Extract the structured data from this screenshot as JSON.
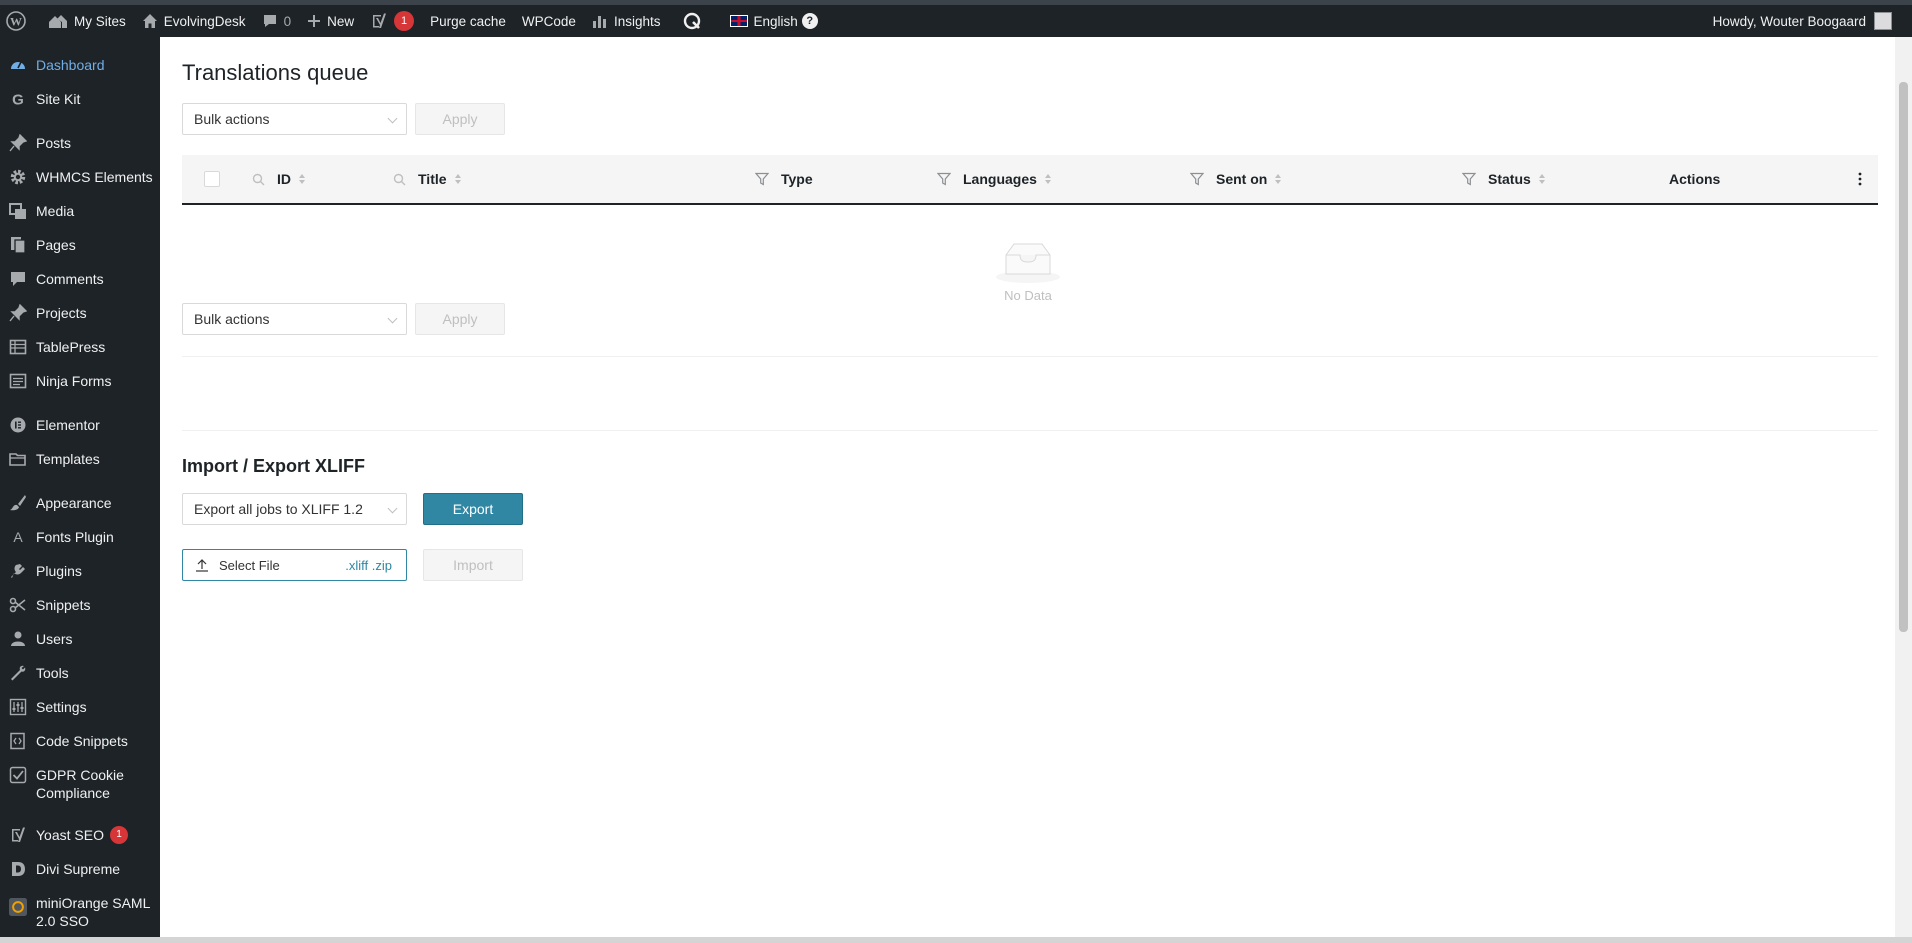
{
  "adminbar": {
    "my_sites": "My Sites",
    "site_name": "EvolvingDesk",
    "comments_count": "0",
    "new_label": "New",
    "yoast_badge": "1",
    "purge_cache": "Purge cache",
    "wpcode": "WPCode",
    "insights": "Insights",
    "language": "English",
    "help": "?",
    "howdy": "Howdy, Wouter Boogaard"
  },
  "sidebar": {
    "items": [
      {
        "label": "Dashboard",
        "icon": "dashboard-icon"
      },
      {
        "label": "Site Kit",
        "icon": "google-icon"
      },
      {
        "label": "Posts",
        "icon": "pin-icon"
      },
      {
        "label": "WHMCS Elements",
        "icon": "gear-icon"
      },
      {
        "label": "Media",
        "icon": "media-icon"
      },
      {
        "label": "Pages",
        "icon": "pages-icon"
      },
      {
        "label": "Comments",
        "icon": "comment-icon"
      },
      {
        "label": "Projects",
        "icon": "pin-icon"
      },
      {
        "label": "TablePress",
        "icon": "table-icon"
      },
      {
        "label": "Ninja Forms",
        "icon": "form-icon"
      },
      {
        "label": "Elementor",
        "icon": "elementor-icon"
      },
      {
        "label": "Templates",
        "icon": "folder-icon"
      },
      {
        "label": "Appearance",
        "icon": "brush-icon"
      },
      {
        "label": "Fonts Plugin",
        "icon": "font-icon"
      },
      {
        "label": "Plugins",
        "icon": "plug-icon"
      },
      {
        "label": "Snippets",
        "icon": "scissors-icon"
      },
      {
        "label": "Users",
        "icon": "user-icon"
      },
      {
        "label": "Tools",
        "icon": "wrench-icon"
      },
      {
        "label": "Settings",
        "icon": "settings-icon"
      },
      {
        "label": "Code Snippets",
        "icon": "code-icon"
      },
      {
        "label": "GDPR Cookie Compliance",
        "icon": "check-icon"
      },
      {
        "label": "Yoast SEO",
        "icon": "yoast-icon",
        "badge": "1"
      },
      {
        "label": "Divi Supreme",
        "icon": "divi-icon"
      },
      {
        "label": "miniOrange SAML 2.0 SSO",
        "icon": "miniorange-icon"
      }
    ]
  },
  "page": {
    "title": "Translations queue",
    "bulk_actions": "Bulk actions",
    "apply": "Apply",
    "columns": {
      "id": "ID",
      "title": "Title",
      "type": "Type",
      "languages": "Languages",
      "sent_on": "Sent on",
      "status": "Status",
      "actions": "Actions"
    },
    "no_data": "No Data",
    "import_export_title": "Import / Export XLIFF",
    "export_select": "Export all jobs to XLIFF 1.2",
    "export_button": "Export",
    "select_file": "Select File",
    "file_types": ".xliff .zip",
    "import_button": "Import"
  },
  "colors": {
    "admin_bg": "#1d2327",
    "active_link": "#72aee6",
    "primary_button": "#2f87a3",
    "badge": "#d63638"
  }
}
